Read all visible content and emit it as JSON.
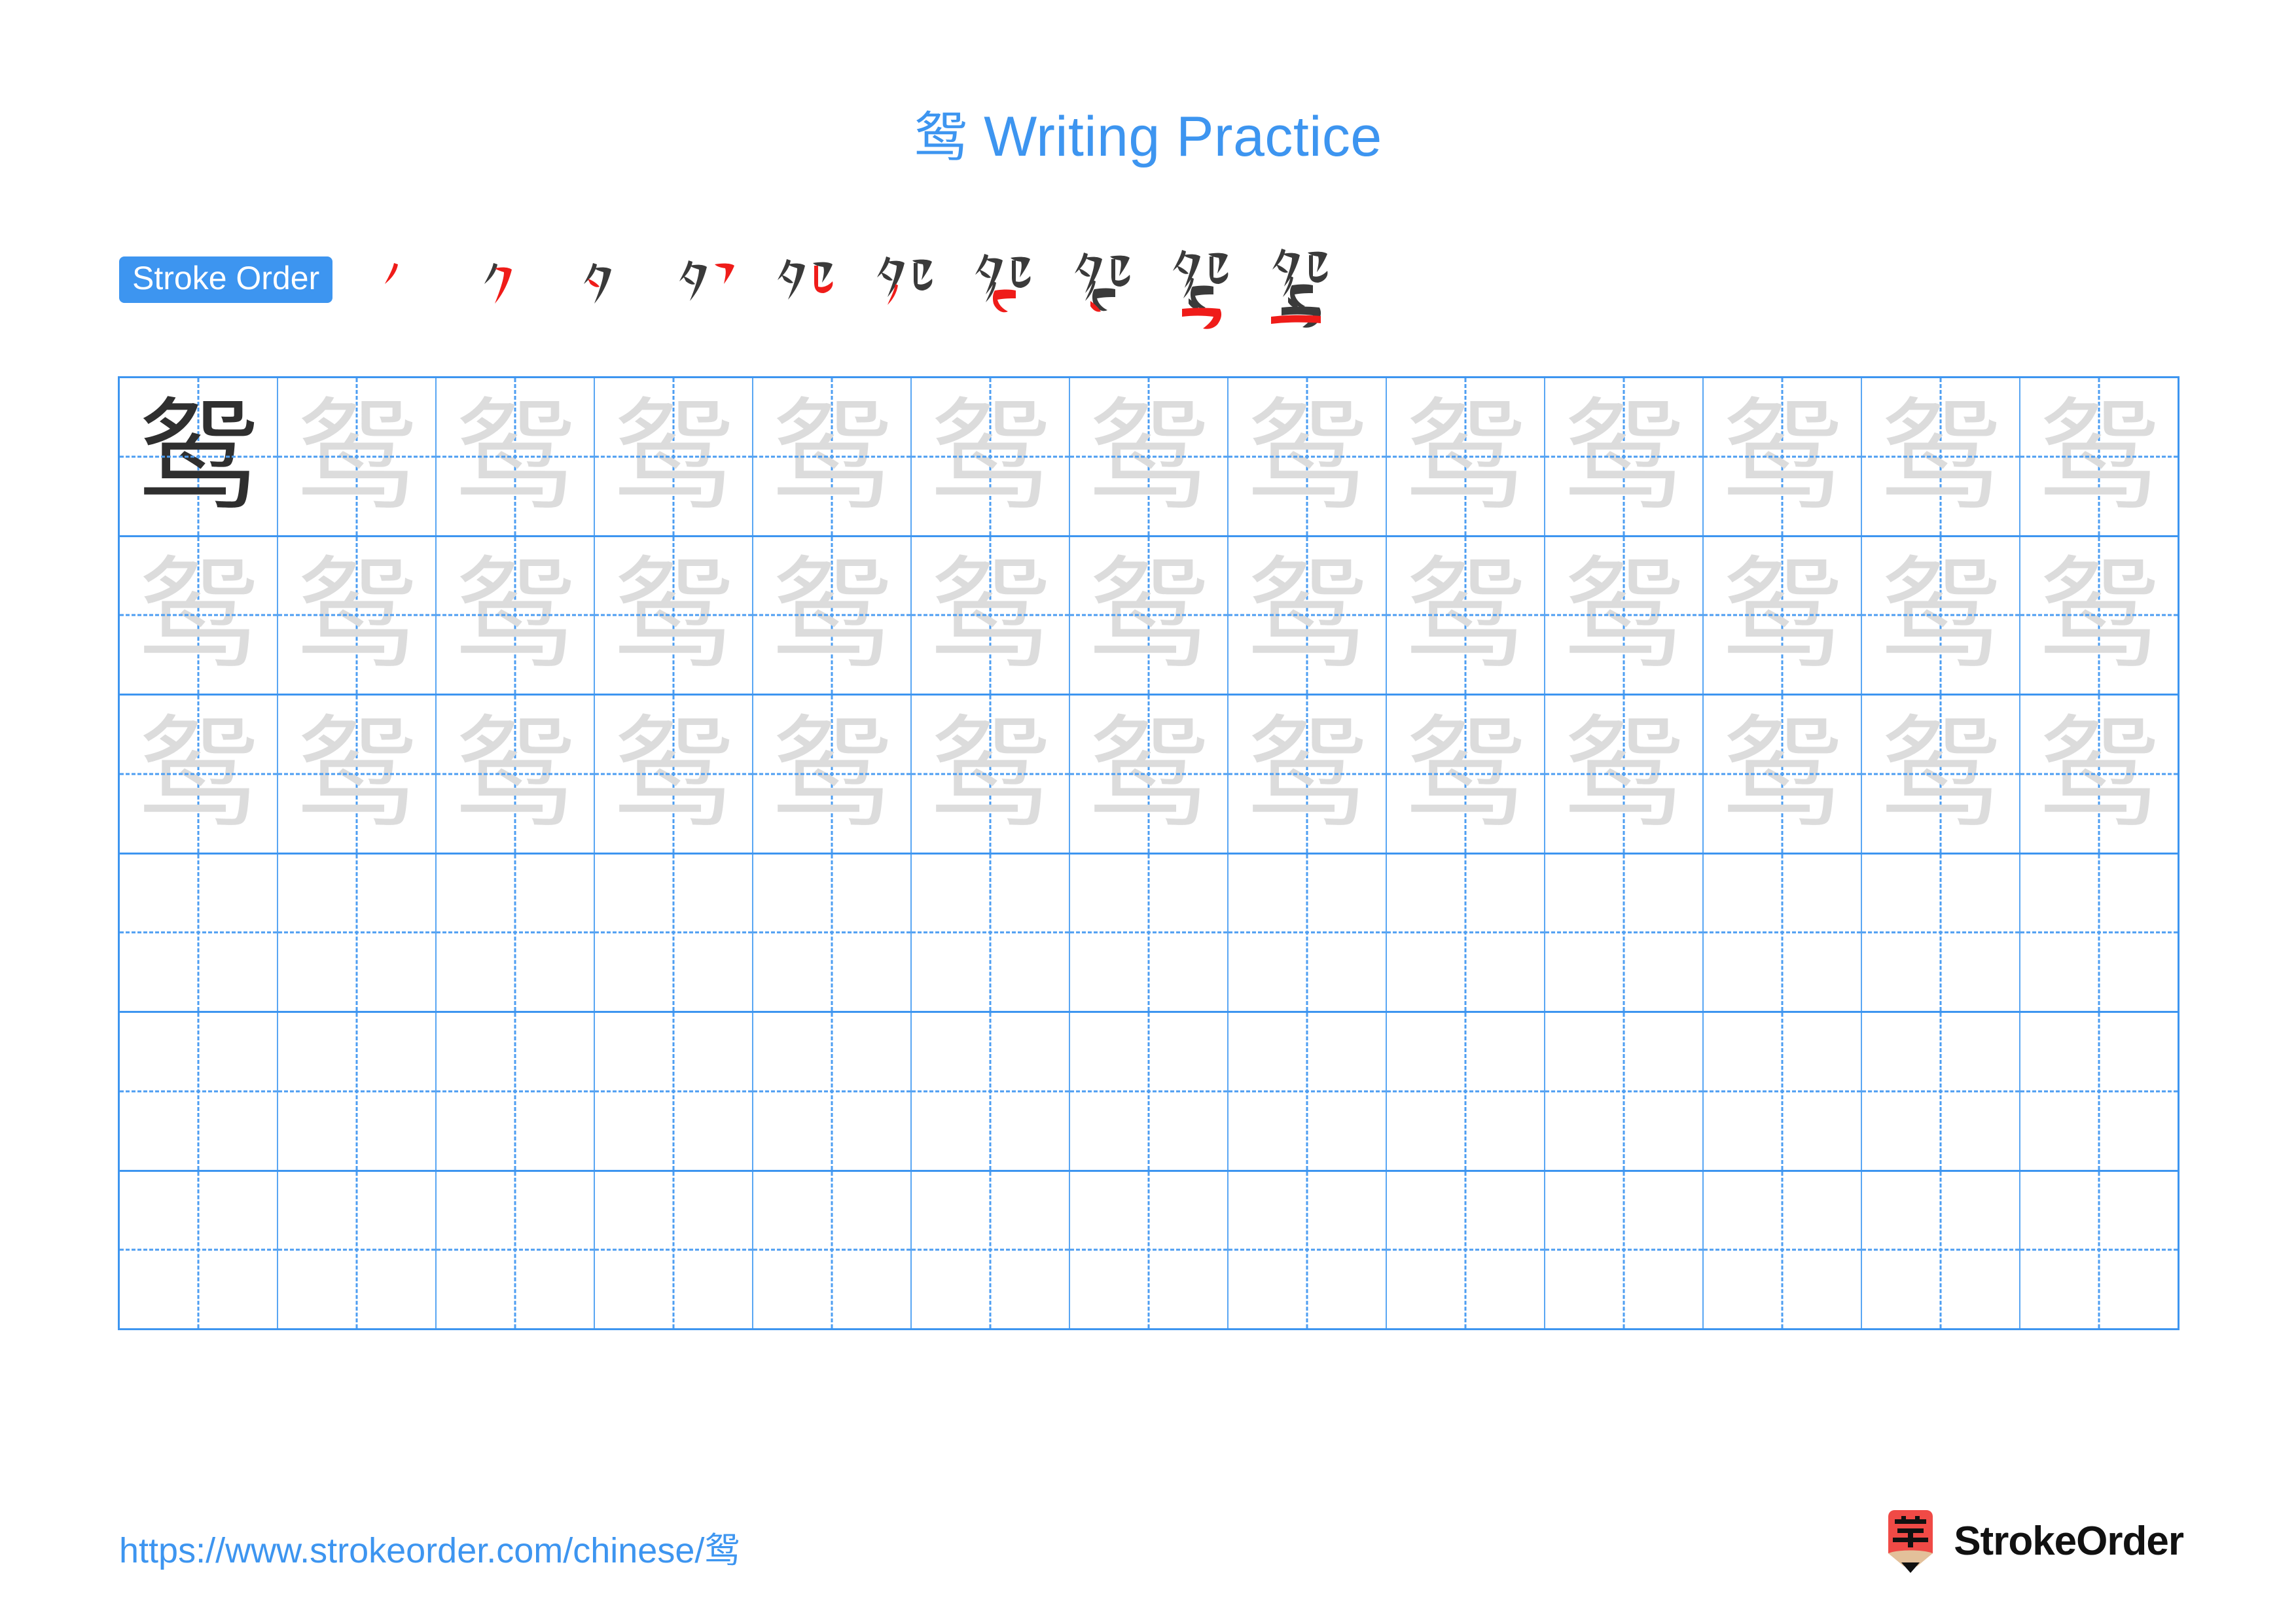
{
  "page": {
    "background_color": "#ffffff",
    "accent_color": "#3d95f0",
    "trace_color": "#dcdcdc",
    "ink_color": "#2f2f2f",
    "highlight_color": "#ef1c19"
  },
  "header": {
    "character": "鸳",
    "title_suffix": " Writing Practice",
    "title_full": "鸳 Writing Practice"
  },
  "stroke_order": {
    "badge_label": "Stroke Order",
    "total_strokes": 10,
    "steps": [
      {
        "index": 1,
        "partial": "丿",
        "new_stroke": "丿"
      },
      {
        "index": 2,
        "partial": "勹",
        "new_stroke": "㇂"
      },
      {
        "index": 3,
        "partial": "夕",
        "new_stroke": "丶"
      },
      {
        "index": 4,
        "partial": "夕𠃌",
        "new_stroke": "㇕"
      },
      {
        "index": 5,
        "partial": "夗",
        "new_stroke": "㇟"
      },
      {
        "index": 6,
        "partial": "夗丿",
        "new_stroke": "丿"
      },
      {
        "index": 7,
        "partial": "夗勹",
        "new_stroke": "㇅"
      },
      {
        "index": 8,
        "partial": "鸳",
        "new_stroke": "丶"
      },
      {
        "index": 9,
        "partial": "鸳",
        "new_stroke": "㇆"
      },
      {
        "index": 10,
        "partial": "鸳",
        "new_stroke": "一"
      }
    ]
  },
  "practice_grid": {
    "columns": 13,
    "rows": 6,
    "cells": [
      [
        "dark",
        "trace",
        "trace",
        "trace",
        "trace",
        "trace",
        "trace",
        "trace",
        "trace",
        "trace",
        "trace",
        "trace",
        "trace"
      ],
      [
        "trace",
        "trace",
        "trace",
        "trace",
        "trace",
        "trace",
        "trace",
        "trace",
        "trace",
        "trace",
        "trace",
        "trace",
        "trace"
      ],
      [
        "trace",
        "trace",
        "trace",
        "trace",
        "trace",
        "trace",
        "trace",
        "trace",
        "trace",
        "trace",
        "trace",
        "trace",
        "trace"
      ],
      [
        "empty",
        "empty",
        "empty",
        "empty",
        "empty",
        "empty",
        "empty",
        "empty",
        "empty",
        "empty",
        "empty",
        "empty",
        "empty"
      ],
      [
        "empty",
        "empty",
        "empty",
        "empty",
        "empty",
        "empty",
        "empty",
        "empty",
        "empty",
        "empty",
        "empty",
        "empty",
        "empty"
      ],
      [
        "empty",
        "empty",
        "empty",
        "empty",
        "empty",
        "empty",
        "empty",
        "empty",
        "empty",
        "empty",
        "empty",
        "empty",
        "empty"
      ]
    ]
  },
  "footer": {
    "url": "https://www.strokeorder.com/chinese/鸳",
    "brand_name": "StrokeOrder",
    "logo_character": "字",
    "logo_body_color": "#f04a46",
    "logo_wood_color": "#e3c09a",
    "logo_tip_color": "#111111"
  }
}
